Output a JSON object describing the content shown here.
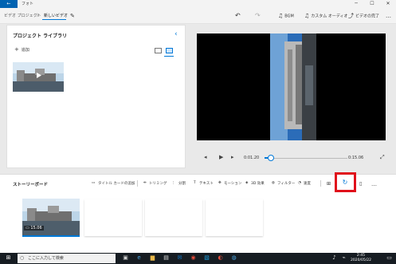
{
  "titlebar": {
    "back": "←",
    "title": "フォト",
    "minimize": "─",
    "maximize": "☐",
    "close": "✕"
  },
  "breadcrumb": {
    "parent": "ビデオ プロジェクト",
    "sep": "〉",
    "current": "新しいビデオ"
  },
  "toolbar": {
    "undo": "↶",
    "redo": "↷",
    "bgm_icon": "♫",
    "bgm_label": "BGM",
    "custom_audio_icon": "♫",
    "custom_audio_label": "カスタム オーディオ",
    "finish_icon": "⤴",
    "finish_label": "ビデオの完了",
    "more": "…"
  },
  "library": {
    "title": "プロジェクト ライブラリ",
    "add_label": "追加"
  },
  "player": {
    "current_time": "0:01.20",
    "total_time": "0:15.06",
    "progress": 0.08
  },
  "storyboard": {
    "title": "ストーリーボード",
    "tools": [
      "タイトル カードの追加",
      "トリミング",
      "分割",
      "テキスト",
      "モーション",
      "3D 効果",
      "フィルター",
      "速度"
    ],
    "clip_duration": "15.06"
  },
  "taskbar": {
    "search_placeholder": "ここに入力して検索",
    "time": "2:45",
    "date": "2020/05/22"
  },
  "colors": {
    "accent": "#0078d7",
    "highlight": "#e0101b"
  },
  "icons": [
    "back-arrow-icon",
    "edit-pencil-icon",
    "undo-icon",
    "redo-icon",
    "music-icon",
    "export-icon",
    "more-icon",
    "plus-icon",
    "chevron-left-icon",
    "grid-view-icon",
    "list-view-icon",
    "previous-frame-icon",
    "play-icon",
    "next-frame-icon",
    "fullscreen-icon",
    "rotate-icon",
    "windows-icon",
    "search-icon",
    "volume-icon"
  ]
}
